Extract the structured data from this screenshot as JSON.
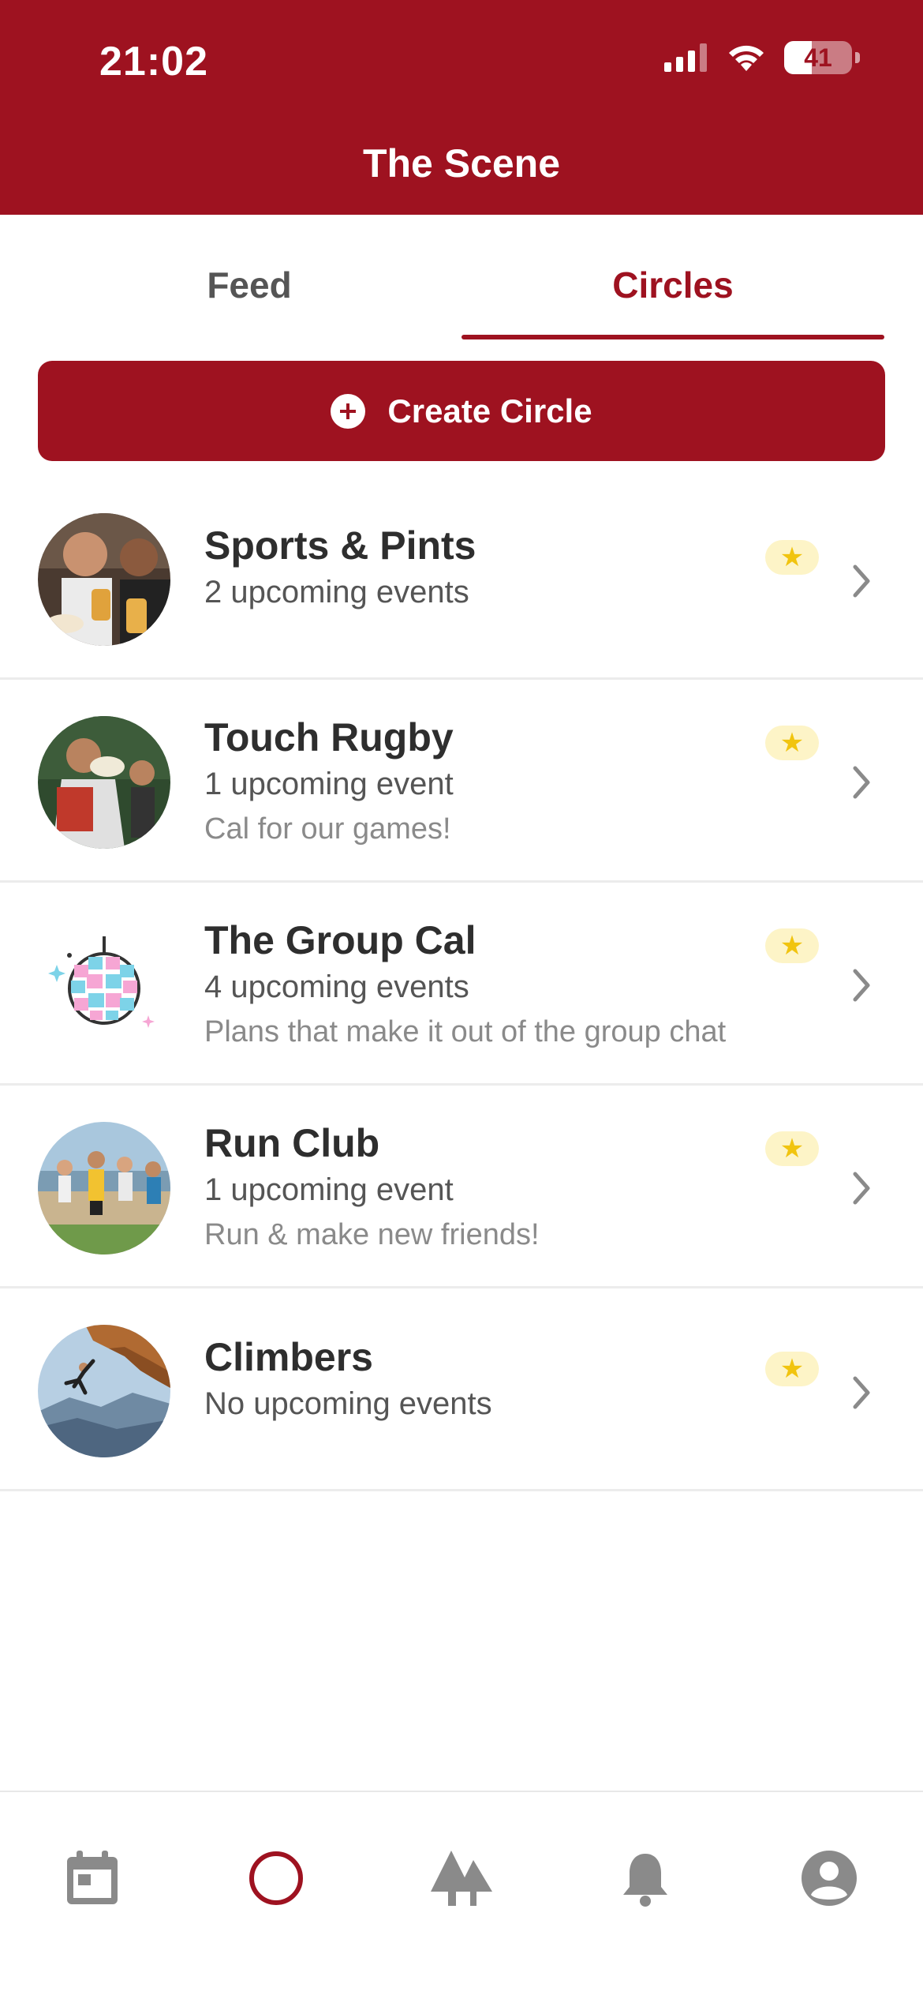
{
  "status": {
    "time": "21:02",
    "battery": "41",
    "battery_level": 0.41
  },
  "header": {
    "title": "The Scene"
  },
  "tabs": [
    {
      "label": "Feed",
      "active": false
    },
    {
      "label": "Circles",
      "active": true
    }
  ],
  "create_button": {
    "label": "Create Circle",
    "icon": "plus-circle-icon"
  },
  "circles": [
    {
      "name": "Sports & Pints",
      "events": "2 upcoming events",
      "description": "",
      "starred": true,
      "avatar": "friends-with-beer-photo"
    },
    {
      "name": "Touch Rugby",
      "events": "1 upcoming event",
      "description": "Cal for our games!",
      "starred": true,
      "avatar": "rugby-players-photo"
    },
    {
      "name": "The Group Cal",
      "events": "4 upcoming events",
      "description": "Plans that make it out of the group chat",
      "starred": true,
      "avatar": "disco-ball-icon"
    },
    {
      "name": "Run Club",
      "events": "1 upcoming event",
      "description": "Run & make new friends!",
      "starred": true,
      "avatar": "runners-photo"
    },
    {
      "name": "Climbers",
      "events": "No upcoming events",
      "description": "",
      "starred": true,
      "avatar": "climber-photo"
    }
  ],
  "tabbar": [
    {
      "icon": "calendar-icon",
      "active": false
    },
    {
      "icon": "circle-icon",
      "active": true
    },
    {
      "icon": "trees-icon",
      "active": false
    },
    {
      "icon": "bell-icon",
      "active": false
    },
    {
      "icon": "profile-icon",
      "active": false
    }
  ],
  "colors": {
    "brand": "#9e1220",
    "star": "#f1c40f",
    "star_bg": "#fdf4c7",
    "muted": "#8a8a8a"
  }
}
